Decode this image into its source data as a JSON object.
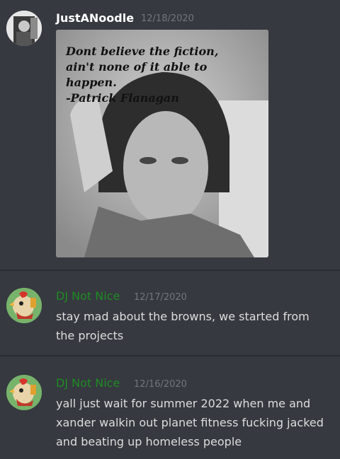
{
  "messages": [
    {
      "username": "JustANoodle",
      "username_color": "#ffffff",
      "timestamp": "12/18/2020",
      "attachment": {
        "quote_lines": [
          "Dont believe the fiction,",
          "ain't none of it able to",
          "happen.",
          "-Patrick Flanagan"
        ]
      }
    },
    {
      "username": "DJ Not Nice",
      "username_color": "#1f8b24",
      "timestamp": "12/17/2020",
      "text_lines": [
        "stay mad about the browns, we started from",
        "the projects"
      ]
    },
    {
      "username": "DJ Not Nice",
      "username_color": "#1f8b24",
      "timestamp": "12/16/2020",
      "text_lines": [
        "yall just wait for summer 2022 when me and",
        "xander walkin out planet fitness fucking jacked",
        "and beating up homeless people"
      ]
    }
  ]
}
